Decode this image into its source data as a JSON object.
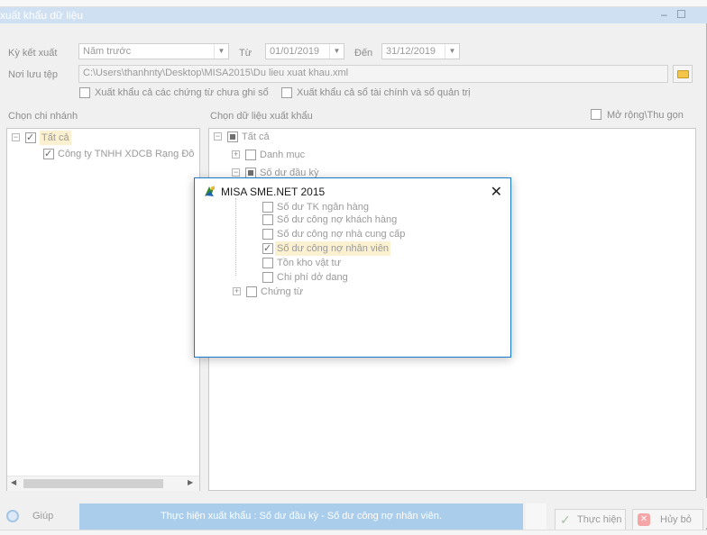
{
  "window": {
    "title": "xuất khẩu dữ liệu",
    "minimize_glyph": "–",
    "maximize_glyph": "☐"
  },
  "period": {
    "label": "Kỳ kết xuất",
    "value": "Năm trước",
    "from_label": "Từ",
    "from_value": "01/01/2019",
    "to_label": "Đến",
    "to_value": "31/12/2019"
  },
  "save_path": {
    "label": "Nơi lưu tệp",
    "value": "C:\\Users\\thanhnty\\Desktop\\MISA2015\\Du lieu xuat khau.xml",
    "folder_icon": "folder-icon"
  },
  "options": {
    "include_unposted": "Xuất khẩu cả các chứng từ chưa ghi sổ",
    "include_books": "Xuất khẩu cả sổ tài chính và sổ quản trị",
    "expand_collapse": "Mở rộng\\Thu gọn"
  },
  "branch_panel": {
    "heading": "Chọn chi nhánh",
    "all_label": "Tất cả",
    "company_label": "Công ty TNHH XDCB Rạng Đô"
  },
  "data_panel": {
    "heading": "Chọn dữ liệu xuất khẩu",
    "all_label": "Tất cả",
    "catalog_label": "Danh mục",
    "opening_label": "Số dư đầu kỳ",
    "items": [
      {
        "label": "Số dư TK ngân hàng",
        "checked": false
      },
      {
        "label": "Số dư công nợ khách hàng",
        "checked": false
      },
      {
        "label": "Số dư công nợ nhà cung cấp",
        "checked": false
      },
      {
        "label": "Số dư công nợ nhân viên",
        "checked": true
      },
      {
        "label": "Tồn kho vật tư",
        "checked": false
      },
      {
        "label": "Chi phí dở dang",
        "checked": false
      }
    ],
    "vouchers_label": "Chứng từ"
  },
  "dialog": {
    "title": "MISA SME.NET 2015",
    "close_glyph": "✕"
  },
  "footer": {
    "help_label": "Giúp",
    "status_text": "Thực hiện xuất khẩu : Số dư đầu kỳ - Số dư công nợ nhân viên.",
    "execute_label": "Thực hiện",
    "cancel_label": "Hủy bỏ"
  },
  "colors": {
    "accent": "#1979ca",
    "status_bar": "#a9cdeb",
    "highlight": "#fbf0cf"
  }
}
